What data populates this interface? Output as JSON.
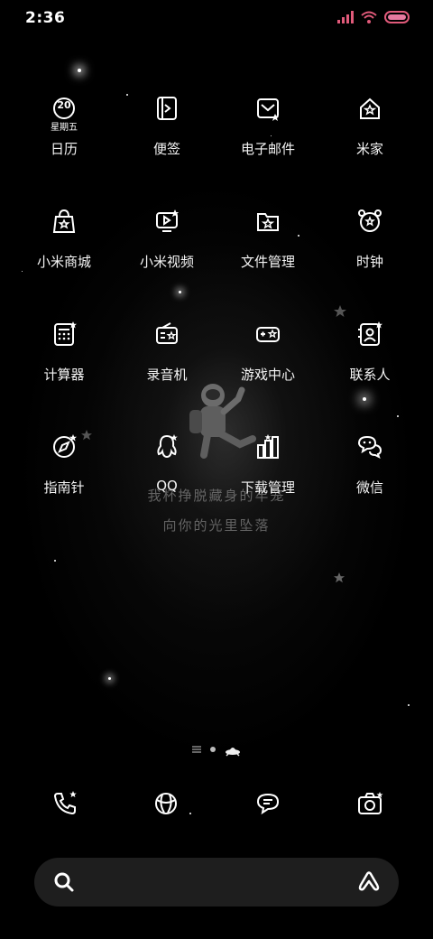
{
  "status_bar": {
    "time": "2:36",
    "icons": [
      "signal-icon",
      "wifi-icon",
      "battery-icon"
    ],
    "battery_color": "#e0508a"
  },
  "apps": [
    {
      "label": "日历",
      "icon": "calendar-icon",
      "day": "20",
      "weekday": "星期五"
    },
    {
      "label": "便签",
      "icon": "notes-icon"
    },
    {
      "label": "电子邮件",
      "icon": "email-icon"
    },
    {
      "label": "米家",
      "icon": "mijia-home-icon"
    },
    {
      "label": "小米商城",
      "icon": "shopping-bag-icon"
    },
    {
      "label": "小米视频",
      "icon": "video-icon"
    },
    {
      "label": "文件管理",
      "icon": "folder-icon"
    },
    {
      "label": "时钟",
      "icon": "alarm-clock-icon"
    },
    {
      "label": "计算器",
      "icon": "calculator-icon"
    },
    {
      "label": "录音机",
      "icon": "recorder-icon"
    },
    {
      "label": "游戏中心",
      "icon": "game-center-icon"
    },
    {
      "label": "联系人",
      "icon": "contacts-icon"
    },
    {
      "label": "指南针",
      "icon": "compass-icon"
    },
    {
      "label": "QQ",
      "icon": "qq-penguin-icon"
    },
    {
      "label": "下载管理",
      "icon": "download-manager-icon"
    },
    {
      "label": "微信",
      "icon": "wechat-icon"
    }
  ],
  "wallpaper": {
    "line1": "我杯挣脱藏身的牢笼",
    "line2": "向你的光里坠落",
    "figure": "astronaut-figure"
  },
  "page_indicator": {
    "pages": [
      "menu-lines",
      "dot",
      "ufo-active"
    ]
  },
  "dock": [
    {
      "name": "phone",
      "icon": "phone-icon"
    },
    {
      "name": "browser",
      "icon": "browser-globe-icon"
    },
    {
      "name": "messages",
      "icon": "message-bubble-icon"
    },
    {
      "name": "camera",
      "icon": "camera-icon"
    }
  ],
  "search": {
    "icon": "search-icon",
    "assistant_icon": "assistant-a-icon"
  }
}
